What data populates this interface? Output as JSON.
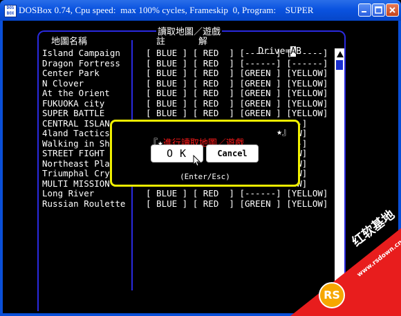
{
  "window": {
    "icon_text": "DOS\nBOX",
    "title": "DOSBox 0.74, Cpu speed:  max 100% cycles, Frameskip  0, Program:    SUPER"
  },
  "header": {
    "top_title": "讀取地圖／遊戲",
    "col_name": "地圖名稱",
    "col_note": "註",
    "col_solve": "解",
    "drive_label": "Drive=",
    "drive_a": "A",
    "drive_b": "B"
  },
  "rows": [
    {
      "name": "Island Campaign",
      "cols": "[ BLUE ] [ RED  ] [------] [------]"
    },
    {
      "name": "Dragon Fortress",
      "cols": "[ BLUE ] [ RED  ] [------] [------]"
    },
    {
      "name": "Center Park",
      "cols": "[ BLUE ] [ RED  ] [GREEN ] [YELLOW]"
    },
    {
      "name": "N Clover",
      "cols": "[ BLUE ] [ RED  ] [GREEN ] [YELLOW]"
    },
    {
      "name": "At the Orient",
      "cols": "[ BLUE ] [ RED  ] [GREEN ] [YELLOW]"
    },
    {
      "name": "FUKUOKA city",
      "cols": "[ BLUE ] [ RED  ] [GREEN ] [YELLOW]"
    },
    {
      "name": "SUPER BATTLE",
      "cols": "[ BLUE ] [ RED  ] [GREEN ] [YELLOW]"
    },
    {
      "name": "CENTRAL ISLAN",
      "cols": "                           ---]"
    },
    {
      "name": "4land Tactics",
      "cols": "                           LOW]"
    },
    {
      "name": "Walking in Sh",
      "cols": "                           ---]"
    },
    {
      "name": "STREET FIGHT",
      "cols": "                           LOW]"
    },
    {
      "name": "Northeast Pla",
      "cols": "                           LOW]"
    },
    {
      "name": "Triumphal Cry",
      "cols": "                           LOW]"
    },
    {
      "name": "MULTI MISSION",
      "cols": "                           LOW]"
    },
    {
      "name": "Long River",
      "cols": "[ BLUE ] [ RED  ] [------] [YELLOW]"
    },
    {
      "name": "Russian Roulette",
      "cols": "[ BLUE ] [ RED  ] [GREEN ] [YELLOW]"
    }
  ],
  "modal": {
    "bracket_left": "『",
    "star": "★",
    "title": "進行讀取地圖／遊戲",
    "right": "★』",
    "ok_label": "OK",
    "cancel_label": "Cancel",
    "footer": "(Enter/Esc)"
  },
  "watermark": {
    "brand": "红软基地",
    "url": "www.rsdown.cn",
    "logo": "RS"
  }
}
